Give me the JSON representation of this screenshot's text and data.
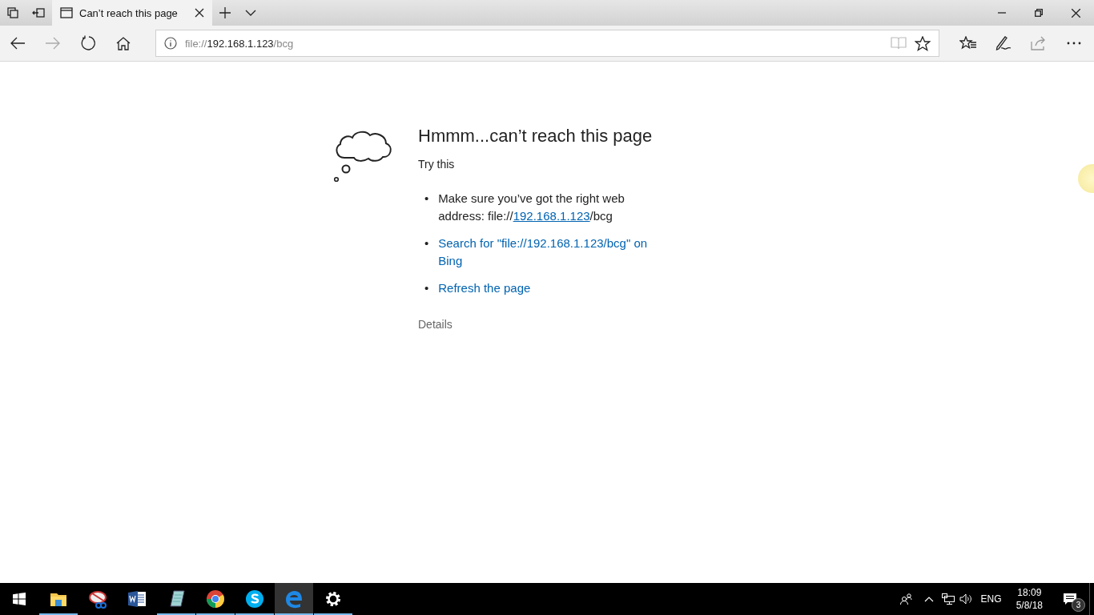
{
  "tab": {
    "title": "Can’t reach this page",
    "selected": true
  },
  "address": {
    "scheme": "file://",
    "host": "192.168.1.123",
    "path": "/bcg"
  },
  "error": {
    "heading": "Hmmm...can’t reach this page",
    "subheading": "Try this",
    "suggestions": [
      {
        "kind": "text",
        "bullet": "•",
        "text": "Make sure you’ve got the right web address: file://",
        "link": "192.168.1.123",
        "after": "/bcg"
      },
      {
        "kind": "link",
        "bullet": "•",
        "text": "Search for \"file://192.168.1.123/bcg\" on Bing"
      },
      {
        "kind": "link",
        "bullet": "•",
        "text": "Refresh the page"
      }
    ],
    "details": "Details"
  },
  "taskbar": {
    "apps": [
      {
        "kind": "explorer",
        "running": true,
        "selected": false
      },
      {
        "kind": "snipping",
        "running": false,
        "selected": false
      },
      {
        "kind": "word",
        "running": false,
        "selected": false
      },
      {
        "kind": "notepad",
        "running": true,
        "selected": false
      },
      {
        "kind": "chrome",
        "running": true,
        "selected": false
      },
      {
        "kind": "skype",
        "running": true,
        "selected": false
      },
      {
        "kind": "edge",
        "running": true,
        "selected": true
      },
      {
        "kind": "settings",
        "running": true,
        "selected": false
      }
    ],
    "language": "ENG",
    "time": "18:09",
    "date": "5/8/18",
    "notifications": "3"
  }
}
